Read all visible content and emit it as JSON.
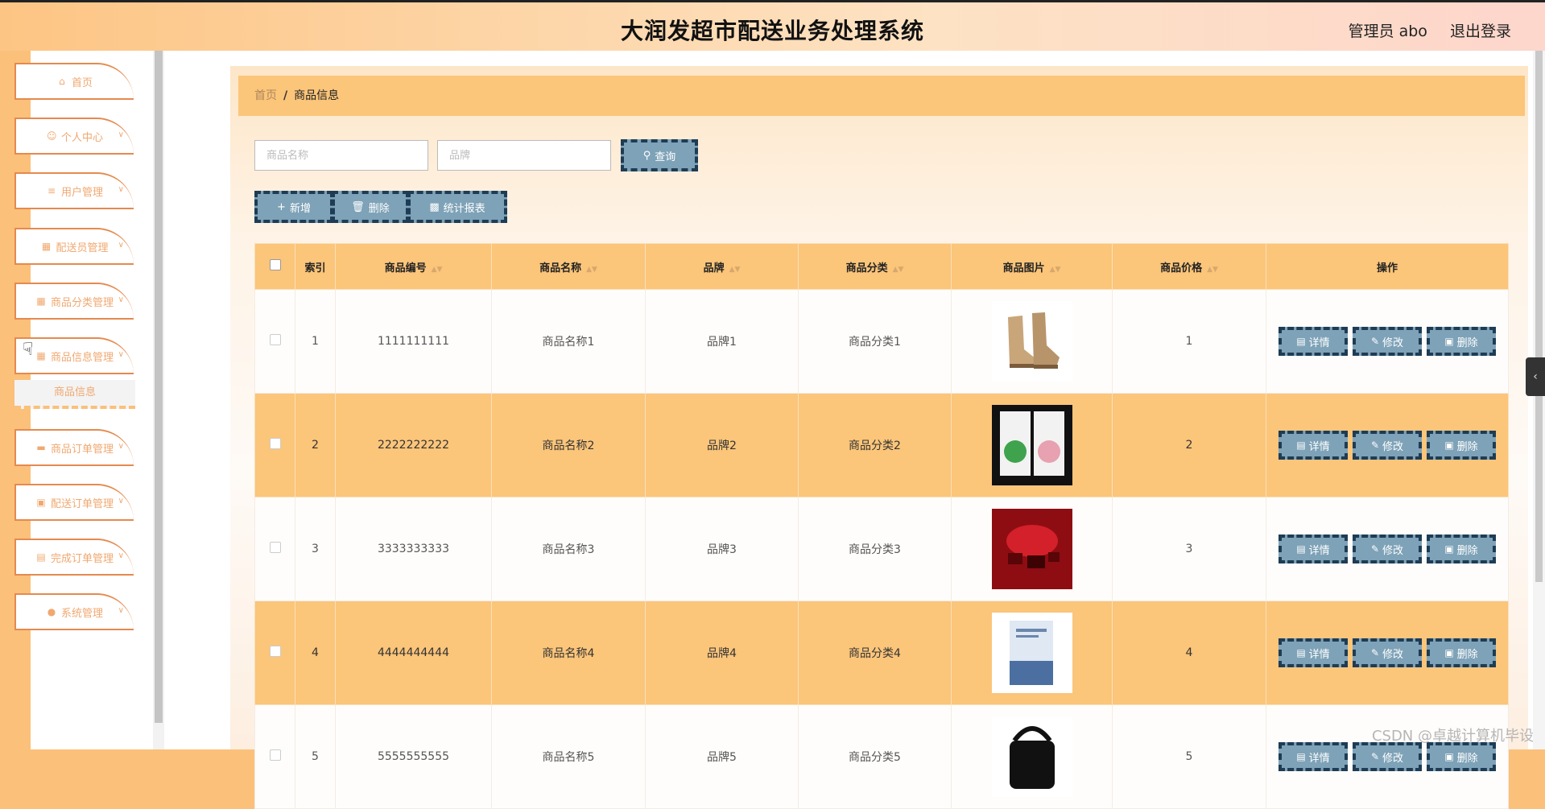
{
  "header": {
    "title": "大润发超市配送业务处理系统",
    "user_label": "管理员 abo",
    "logout_label": "退出登录"
  },
  "sidebar": {
    "items": [
      {
        "label": "首页",
        "icon": "home-icon"
      },
      {
        "label": "个人中心",
        "icon": "user-icon"
      },
      {
        "label": "用户管理",
        "icon": "sliders-icon"
      },
      {
        "label": "配送员管理",
        "icon": "grid-icon"
      },
      {
        "label": "商品分类管理",
        "icon": "grid-icon"
      },
      {
        "label": "商品信息管理",
        "icon": "grid-icon"
      },
      {
        "label": "商品订单管理",
        "icon": "monitor-icon"
      },
      {
        "label": "配送订单管理",
        "icon": "box-icon"
      },
      {
        "label": "完成订单管理",
        "icon": "clipboard-icon"
      },
      {
        "label": "系统管理",
        "icon": "pin-icon"
      }
    ],
    "submenu": {
      "label": "商品信息"
    }
  },
  "breadcrumb": {
    "home": "首页",
    "separator": "/",
    "current": "商品信息"
  },
  "search": {
    "name_placeholder": "商品名称",
    "brand_placeholder": "品牌",
    "query_label": "查询"
  },
  "toolbar": {
    "add_label": "新增",
    "delete_label": "删除",
    "stats_label": "统计报表"
  },
  "table": {
    "headers": {
      "index": "索引",
      "code": "商品编号",
      "name": "商品名称",
      "brand": "品牌",
      "category": "商品分类",
      "image": "商品图片",
      "price": "商品价格",
      "actions": "操作"
    },
    "actions": {
      "detail": "详情",
      "edit": "修改",
      "delete": "删除"
    },
    "rows": [
      {
        "index": "1",
        "code": "1111111111",
        "name": "商品名称1",
        "brand": "品牌1",
        "category": "商品分类1",
        "image": "boots",
        "price": "1"
      },
      {
        "index": "2",
        "code": "2222222222",
        "name": "商品名称2",
        "brand": "品牌2",
        "category": "商品分类2",
        "image": "face-mask-box",
        "price": "2"
      },
      {
        "index": "3",
        "code": "3333333333",
        "name": "商品名称3",
        "brand": "品牌3",
        "category": "商品分类3",
        "image": "red-gift",
        "price": "3"
      },
      {
        "index": "4",
        "code": "4444444444",
        "name": "商品名称4",
        "brand": "品牌4",
        "category": "商品分类4",
        "image": "book",
        "price": "4"
      },
      {
        "index": "5",
        "code": "5555555555",
        "name": "商品名称5",
        "brand": "品牌5",
        "category": "商品分类5",
        "image": "bag",
        "price": "5"
      }
    ]
  },
  "watermark": "CSDN @卓越计算机毕设",
  "colors": {
    "accent": "#fbc57a",
    "button": "#7ea2b7",
    "button_border": "#1e3c55",
    "menu_border": "#e58a4f",
    "menu_text": "#f0a870"
  }
}
